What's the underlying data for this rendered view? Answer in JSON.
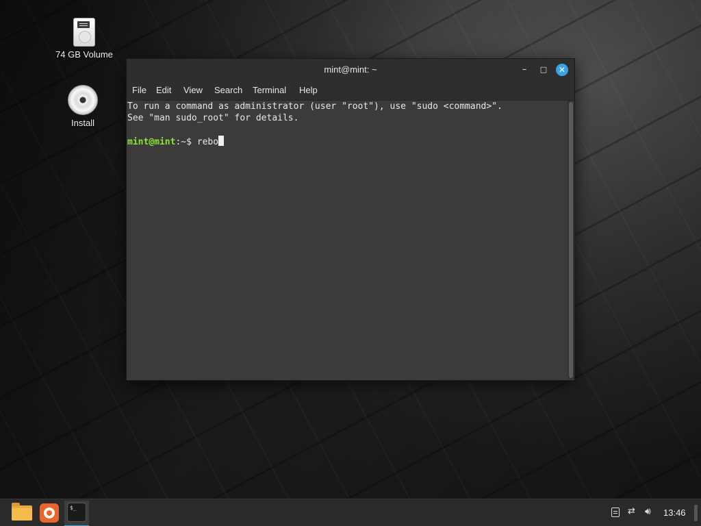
{
  "desktop": {
    "icons": [
      {
        "label": "74 GB Volume",
        "icon": "drive-icon"
      },
      {
        "label": "Install",
        "icon": "cd-icon"
      }
    ]
  },
  "terminal": {
    "title": "mint@mint: ~",
    "menu": [
      "File",
      "Edit",
      "View",
      "Search",
      "Terminal",
      "Help"
    ],
    "lines": [
      "To run a command as administrator (user \"root\"), use \"sudo <command>\".",
      "See \"man sudo_root\" for details."
    ],
    "prompt": {
      "user_host": "mint@mint",
      "path": ":~",
      "symbol": "$ ",
      "input": "rebo"
    },
    "colors": {
      "prompt_user": "#8ae234",
      "close_button": "#3aa3e3"
    }
  },
  "taskbar": {
    "launchers": [
      "folder-icon",
      "firefox-icon",
      "terminal-icon"
    ],
    "terminal_glyph": "$_",
    "tray_icons": [
      "notes-icon",
      "network-disconnected-icon",
      "volume-icon"
    ],
    "clock": "13:46"
  }
}
